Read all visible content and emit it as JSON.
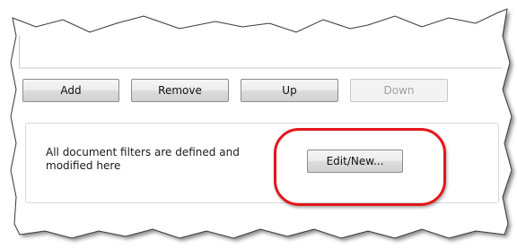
{
  "list_buttons": {
    "add": "Add",
    "remove": "Remove",
    "up": "Up",
    "down": "Down"
  },
  "filters_panel": {
    "description": "All document filters are defined and modified here",
    "edit_new": "Edit/New..."
  },
  "colors": {
    "highlight": "#e3161c",
    "disabled_text": "#a0a0a0",
    "torn_edge_shadow": "#7a7a7a"
  }
}
